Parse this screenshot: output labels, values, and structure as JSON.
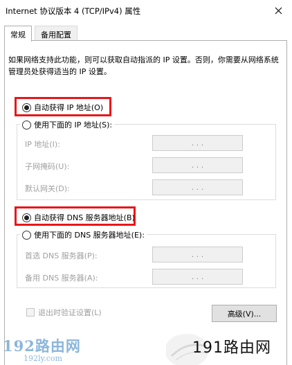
{
  "window": {
    "title": "Internet 协议版本 4 (TCP/IPv4) 属性"
  },
  "tabs": [
    {
      "label": "常规"
    },
    {
      "label": "备用配置"
    }
  ],
  "description": "如果网络支持此功能，则可以获取自动指派的 IP 设置。否则，你需要从网络系统管理员处获得适当的 IP 设置。",
  "ip": {
    "auto_label": "自动获得 IP 地址(O)",
    "manual_label": "使用下面的 IP 地址(S):",
    "fields": [
      {
        "label": "IP 地址(I):",
        "value": ". . ."
      },
      {
        "label": "子网掩码(U):",
        "value": ". . ."
      },
      {
        "label": "默认网关(D):",
        "value": ". . ."
      }
    ]
  },
  "dns": {
    "auto_label": "自动获得 DNS 服务器地址(B)",
    "manual_label": "使用下面的 DNS 服务器地址(E):",
    "fields": [
      {
        "label": "首选 DNS 服务器(P):",
        "value": ". . ."
      },
      {
        "label": "备用 DNS 服务器(A):",
        "value": ". . ."
      }
    ]
  },
  "validate_label": "退出时验证设置(L)",
  "advanced_label": "高级(V)...",
  "watermark": {
    "left_main": "192路由网",
    "left_sub": "192ly.com",
    "right_text": "191路由网"
  },
  "colors": {
    "highlight": "#e8161b",
    "watermark_blue": "#8bb6dd"
  }
}
